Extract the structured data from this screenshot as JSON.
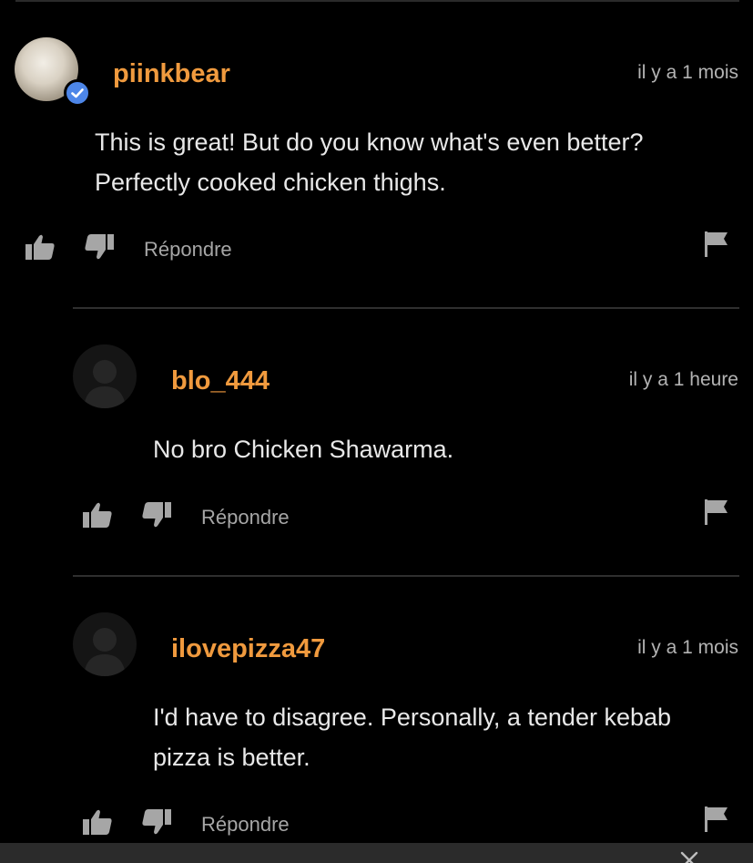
{
  "comments": [
    {
      "username": "piinkbear",
      "timestamp": "il y a 1 mois",
      "text_lines": [
        "This is great! But do you know what's even better?",
        "Perfectly cooked chicken thighs."
      ],
      "reply_label": "Répondre",
      "avatar": "photo-avatar",
      "verified": true
    },
    {
      "username": "blo_444",
      "timestamp": "il y a 1 heure",
      "text_lines": [
        "No bro Chicken Shawarma."
      ],
      "reply_label": "Répondre",
      "avatar": "default-avatar",
      "verified": false
    },
    {
      "username": "ilovepizza47",
      "timestamp": "il y a 1 mois",
      "text_lines": [
        "I'd have to disagree. Personally, a tender kebab",
        "pizza is better."
      ],
      "reply_label": "Répondre",
      "avatar": "default-avatar",
      "verified": false
    }
  ],
  "icons": {
    "like": "thumbs-up-icon",
    "dislike": "thumbs-down-icon",
    "flag": "flag-icon",
    "verified": "verified-check-icon",
    "close": "close-icon"
  },
  "colors": {
    "background": "#000000",
    "username": "#f09a3e",
    "text": "#e8e8e8",
    "muted": "#a6a6a6",
    "divider": "#2f2f2f",
    "verified_badge": "#4d86e8"
  }
}
